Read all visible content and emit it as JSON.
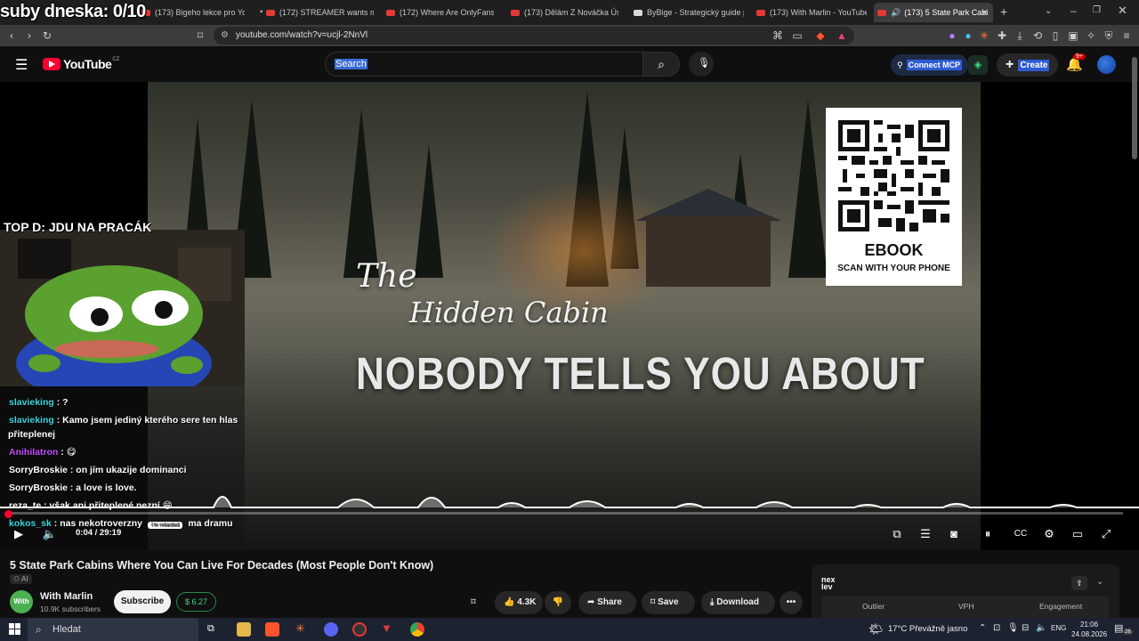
{
  "browser": {
    "tabs": [
      {
        "title": "(173) Bigeho lekce pro YouTub",
        "active": false
      },
      {
        "title": "(172) STREAMER wants my frie",
        "active": false
      },
      {
        "title": "(172) Where Are OnlyFans Mi",
        "active": false
      },
      {
        "title": "(173) Dělám Z Nováčka Úspěš",
        "active": false
      },
      {
        "title": "ByBige - Strategický guide pro",
        "active": false
      },
      {
        "title": "(173) With Marlin - YouTube",
        "active": false
      },
      {
        "title": "(173) 5 State Park Cabi",
        "active": true
      }
    ],
    "new_tab": "+",
    "url": "youtube.com/watch?v=ucjl-2NnVl"
  },
  "youtube": {
    "logo": "YouTube",
    "region": "CZ",
    "search_placeholder": "Search",
    "connect_mcp": "Connect MCP",
    "create": "Create",
    "notifications": "9+"
  },
  "video": {
    "title_line1": "The",
    "title_line2": "Hidden Cabin",
    "title_line3": "NOBODY TELLS YOU ABOUT",
    "qr_title": "EBOOK",
    "qr_subtitle": "SCAN WITH YOUR PHONE",
    "time": "0:04 / 29:19",
    "progress": 0.002
  },
  "stream_overlay": {
    "subs_counter": "suby dneska: 0/10",
    "top_donor": "TOP D: JDU NA PRACÁK",
    "chat": [
      {
        "user": "slavieking",
        "color": "cyan",
        "msg": ": ?"
      },
      {
        "user": "slavieking",
        "color": "cyan",
        "msg": ": Kamo jsem jediný kterého sere ten hlas"
      },
      {
        "user": "",
        "color": "cyan",
        "msg": "přiteplenej"
      },
      {
        "user": "Anihilatron",
        "color": "purple",
        "msg": ": 😋"
      },
      {
        "user": "SorryBroskie",
        "color": "white",
        "msg": ": on jím ukazije dominanci"
      },
      {
        "user": "SorryBroskie",
        "color": "white",
        "msg": ": a love is love."
      },
      {
        "user": "reza_te",
        "color": "white",
        "msg": ": však ani přiteplené nezní 😁"
      },
      {
        "user": "kokos_sk",
        "color": "cyan",
        "msg": ": nas nekotroverzny"
      },
      {
        "user": "",
        "color": "white",
        "msg": "ma dramu"
      }
    ],
    "chat_badge": "i'm retarded"
  },
  "below_video": {
    "title": "5 State Park Cabins Where You Can Live For Decades (Most People Don't Know)",
    "ai_badge": "AI",
    "channel_avatar": "With Marlin",
    "channel_name": "With Marlin",
    "channel_subs": "10.9K subscribers",
    "subscribe": "Subscribe",
    "tip": "6.27",
    "likes": "4.3K",
    "share": "Share",
    "save": "Save",
    "download": "Download",
    "more": "•••"
  },
  "side_panel": {
    "logo": "nex lev",
    "col1": "Outlier",
    "col2": "VPH",
    "col3": "Engagement"
  },
  "taskbar": {
    "search": "Hledat",
    "weather": "17°C  Převážně jasno",
    "lang": "ENG",
    "time": "21:06",
    "date": "24.08.2026",
    "notif_count": "26"
  }
}
